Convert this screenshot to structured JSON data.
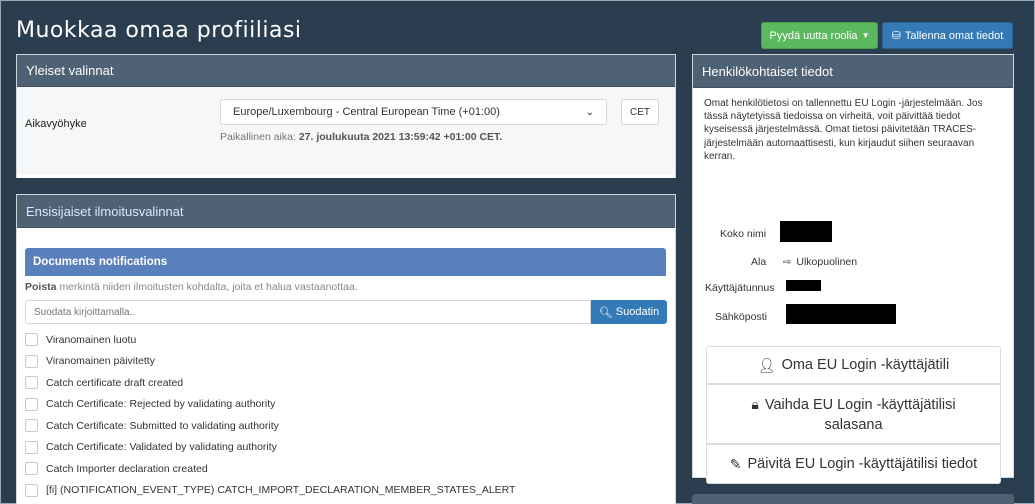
{
  "header": {
    "title": "Muokkaa omaa profiiliasi",
    "role_button": "Pyydä uutta roolia",
    "save_button": "Tallenna omat tiedot"
  },
  "general": {
    "heading": "Yleiset valinnat",
    "timezone_label": "Aikavyöhyke",
    "timezone_value": "Europe/Luxembourg - Central European Time (+01:00)",
    "timezone_badge": "CET",
    "local_time_prefix": "Paikallinen aika:",
    "local_time_value": "27. joulukuuta 2021 13:59:42 +01:00 CET."
  },
  "notifications": {
    "heading": "Ensisijaiset ilmoitusvalinnat",
    "documents_heading": "Documents notifications",
    "instruction_bold": "Poista",
    "instruction_rest": "merkintä niiden ilmoitusten kohdalta, joita et halua vastaanottaa.",
    "filter_placeholder": "Suodata kirjoittamalla..",
    "filter_button": "Suodatin",
    "items": [
      "Viranomainen luotu",
      "Viranomainen päivitetty",
      "Catch certificate draft created",
      "Catch Certificate: Rejected by validating authority",
      "Catch Certificate: Submitted to validating authority",
      "Catch Certificate: Validated by validating authority",
      "Catch Importer declaration created",
      "[fi] (NOTIFICATION_EVENT_TYPE) CATCH_IMPORT_DECLARATION_MEMBER_STATES_ALERT"
    ]
  },
  "personal": {
    "heading": "Henkilökohtaiset tiedot",
    "intro": "Omat henkilötietosi on tallennettu EU Login -järjestelmään. Jos tässä näytetyissä tiedoissa on virheitä, voit päivittää tiedot kyseisessä järjestelmässä. Omat tietosi päivitetään TRACES-järjestelmään automaattisesti, kun kirjaudut siihen seuraavan kerran.",
    "full_name_label": "Koko nimi",
    "domain_label": "Ala",
    "domain_value": "Ulkopuolinen",
    "username_label": "Käyttäjätunnus",
    "email_label": "Sähköposti",
    "btn_account": "Oma EU Login -käyttäjätili",
    "btn_password_line1": "Vaihda EU Login -käyttäjätilisi",
    "btn_password_line2": "salasana",
    "btn_update": "Päivitä EU Login -käyttäjätilisi tiedot"
  },
  "colors": {
    "background": "#2b3e50",
    "panel_heading": "#4e6274",
    "success": "#5cb85c",
    "primary": "#337ab7",
    "docs_header": "#5a7fbd"
  }
}
